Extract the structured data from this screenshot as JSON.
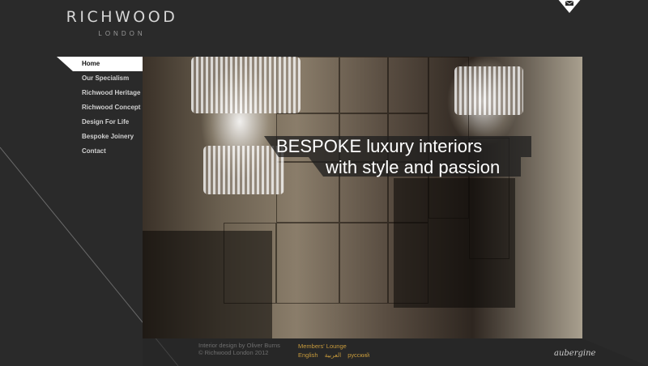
{
  "brand": {
    "name": "RICHWOOD",
    "location": "LONDON"
  },
  "header": {
    "mail_icon": "envelope-icon"
  },
  "nav": {
    "items": [
      {
        "label": "Home",
        "active": true
      },
      {
        "label": "Our Specialism",
        "active": false
      },
      {
        "label": "Richwood Heritage",
        "active": false
      },
      {
        "label": "Richwood Concept",
        "active": false
      },
      {
        "label": "Design For Life",
        "active": false
      },
      {
        "label": "Bespoke Joinery",
        "active": false
      },
      {
        "label": "Contact",
        "active": false
      }
    ]
  },
  "hero": {
    "line1": "BESPOKE luxury interiors",
    "line2": "with style and passion"
  },
  "footer": {
    "credit_line1": "Interior design by Oliver Burns",
    "credit_line2": "© Richwood London 2012",
    "members": "Members' Lounge",
    "languages": [
      "English",
      "العربية",
      "русский"
    ],
    "designer": "aubergine"
  },
  "colors": {
    "background": "#2a2a2a",
    "accent": "#c79a3c",
    "nav_active": "#ffffff"
  }
}
